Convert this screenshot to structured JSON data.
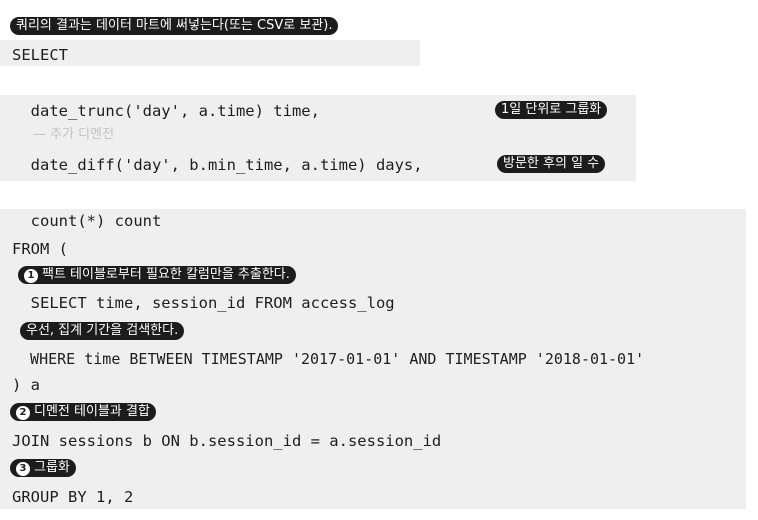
{
  "notes": {
    "top": "쿼리의 결과는 데이터 마트에 써넣는다(또는 CSV로 보관).",
    "day_group": "1일 단위로 그룹화",
    "added_dimension": "— 추가 디멘전",
    "days_visited": "방문한 후의 일 수",
    "step1": "팩트 테이블로부터 필요한 칼럼만을 추출한다.",
    "step1_num": "1",
    "filter_period": "우선, 집계 기간을 검색한다.",
    "step2": "디멘전 테이블과 결합",
    "step2_num": "2",
    "step3": "그룹화",
    "step3_num": "3"
  },
  "code": {
    "l_select": "SELECT",
    "l_date_trunc": "  date_trunc('day', a.time) time,",
    "l_date_diff": "  date_diff('day', b.min_time, a.time) days,",
    "l_count": "  count(*) count",
    "l_from": "FROM (",
    "l_inner_select": "  SELECT time, session_id FROM access_log",
    "l_where": "  WHERE time BETWEEN TIMESTAMP '2017-01-01' AND TIMESTAMP '2018-01-01'",
    "l_close": ") a",
    "l_join": "JOIN sessions b ON b.session_id = a.session_id",
    "l_group": "GROUP BY 1, 2"
  }
}
